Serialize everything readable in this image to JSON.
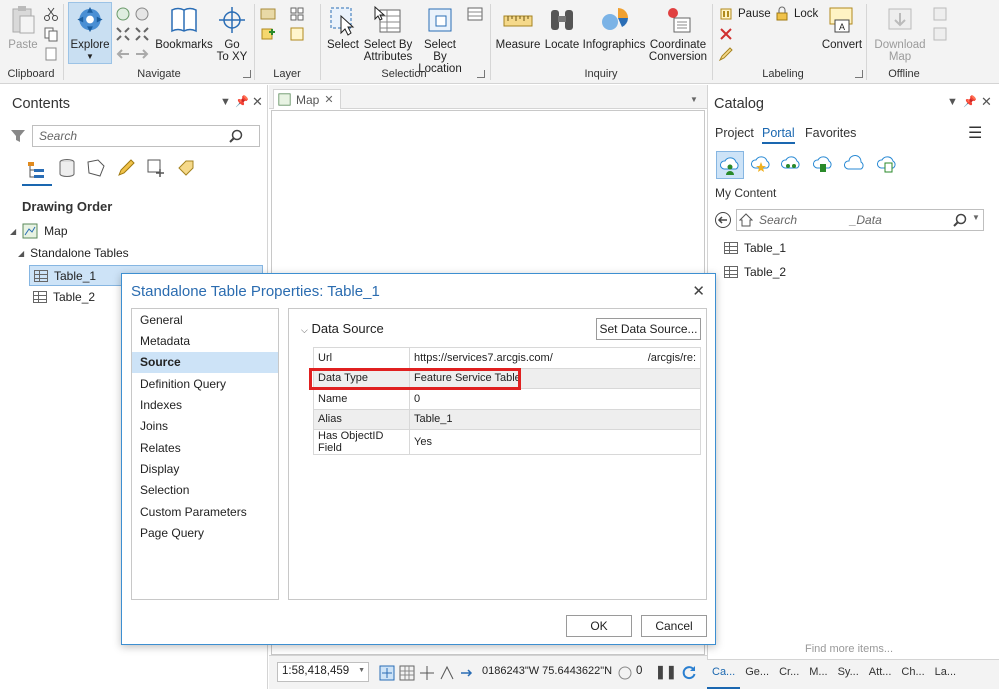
{
  "ribbon": {
    "clipboard": {
      "paste": "Paste",
      "label": "Clipboard"
    },
    "navigate": {
      "explore": "Explore",
      "bookmarks": "Bookmarks",
      "goto_line1": "Go",
      "goto_line2": "To XY",
      "label": "Navigate"
    },
    "layer": {
      "label": "Layer"
    },
    "selection": {
      "select": "Select",
      "select_by_attr_1": "Select By",
      "select_by_attr_2": "Attributes",
      "select_by_loc_1": "Select By",
      "select_by_loc_2": "Location",
      "label": "Selection"
    },
    "inquiry": {
      "measure": "Measure",
      "locate": "Locate",
      "infographics": "Infographics",
      "coord_1": "Coordinate",
      "coord_2": "Conversion",
      "label": "Inquiry"
    },
    "labeling": {
      "pause": "Pause",
      "lock": "Lock",
      "convert": "Convert",
      "label": "Labeling"
    },
    "offline": {
      "download_1": "Download",
      "download_2": "Map",
      "label": "Offline"
    }
  },
  "contents": {
    "title": "Contents",
    "search_placeholder": "Search",
    "section": "Drawing Order",
    "map": "Map",
    "standalone": "Standalone Tables",
    "tables": [
      "Table_1",
      "Table_2"
    ]
  },
  "mapview": {
    "tab": "Map"
  },
  "catalog": {
    "title": "Catalog",
    "tabs": [
      "Project",
      "Portal",
      "Favorites"
    ],
    "my_content": "My Content",
    "search_placeholder": "Search",
    "search_suffix": "_Data",
    "items": [
      "Table_1",
      "Table_2"
    ],
    "find_more": "Find more items...",
    "bottom_tabs": [
      "Ca...",
      "Ge...",
      "Cr...",
      "M...",
      "Sy...",
      "Att...",
      "Ch...",
      "La..."
    ]
  },
  "dialog": {
    "title": "Standalone Table Properties: Table_1",
    "nav": [
      "General",
      "Metadata",
      "Source",
      "Definition Query",
      "Indexes",
      "Joins",
      "Relates",
      "Display",
      "Selection",
      "Custom Parameters",
      "Page Query"
    ],
    "nav_selected": "Source",
    "section": "Data Source",
    "set_button": "Set Data Source...",
    "rows": [
      {
        "key": "Url",
        "value": "https://services7.arcgis.com/",
        "value2": "/arcgis/re:"
      },
      {
        "key": "Data Type",
        "value": "Feature Service Table",
        "value2": ""
      },
      {
        "key": "Name",
        "value": "0",
        "value2": ""
      },
      {
        "key": "Alias",
        "value": "Table_1",
        "value2": ""
      },
      {
        "key": "Has ObjectID Field",
        "value": "Yes",
        "value2": ""
      }
    ],
    "ok": "OK",
    "cancel": "Cancel"
  },
  "status": {
    "scale": "1:58,418,459",
    "coords": "0186243\"W 75.6443622\"N",
    "count": "0"
  },
  "colors": {
    "accent": "#1a67b0",
    "highlight": "#e02020",
    "selected": "#cde3f7"
  }
}
